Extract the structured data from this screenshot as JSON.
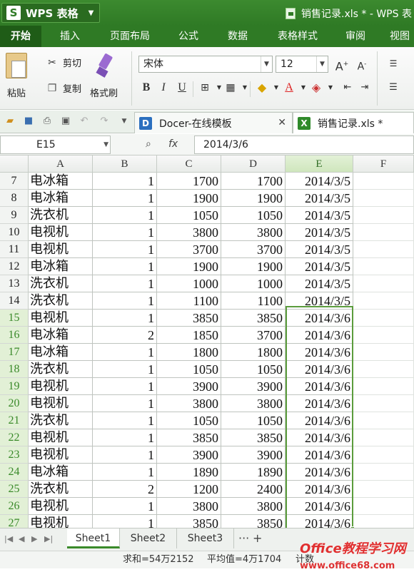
{
  "app": {
    "logo_letter": "S",
    "name": "WPS 表格",
    "window_title": "销售记录.xls * - WPS 表"
  },
  "menu": {
    "tabs": [
      "开始",
      "插入",
      "页面布局",
      "公式",
      "数据",
      "表格样式",
      "审阅",
      "视图"
    ],
    "active": "开始"
  },
  "ribbon": {
    "paste": "粘贴",
    "cut": "剪切",
    "copy": "复制",
    "format_painter": "格式刷",
    "font_name": "宋体",
    "font_size": "12",
    "bold": "B",
    "italic": "I",
    "underline": "U"
  },
  "doc_tabs": [
    {
      "label": "Docer-在线模板",
      "icon": "docer-icon"
    },
    {
      "label": "销售记录.xls *",
      "icon": "xls-icon"
    }
  ],
  "formula_bar": {
    "cell_ref": "E15",
    "fx": "fx",
    "value": "2014/3/6"
  },
  "columns": [
    "A",
    "B",
    "C",
    "D",
    "E",
    "F"
  ],
  "selected_column": "E",
  "rows": [
    {
      "n": "7",
      "a": "电冰箱",
      "b": "1",
      "c": "1700",
      "d": "1700",
      "e": "2014/3/5"
    },
    {
      "n": "8",
      "a": "电冰箱",
      "b": "1",
      "c": "1900",
      "d": "1900",
      "e": "2014/3/5"
    },
    {
      "n": "9",
      "a": "洗衣机",
      "b": "1",
      "c": "1050",
      "d": "1050",
      "e": "2014/3/5"
    },
    {
      "n": "10",
      "a": "电视机",
      "b": "1",
      "c": "3800",
      "d": "3800",
      "e": "2014/3/5"
    },
    {
      "n": "11",
      "a": "电视机",
      "b": "1",
      "c": "3700",
      "d": "3700",
      "e": "2014/3/5"
    },
    {
      "n": "12",
      "a": "电冰箱",
      "b": "1",
      "c": "1900",
      "d": "1900",
      "e": "2014/3/5"
    },
    {
      "n": "13",
      "a": "洗衣机",
      "b": "1",
      "c": "1000",
      "d": "1000",
      "e": "2014/3/5"
    },
    {
      "n": "14",
      "a": "洗衣机",
      "b": "1",
      "c": "1100",
      "d": "1100",
      "e": "2014/3/5"
    },
    {
      "n": "15",
      "a": "电视机",
      "b": "1",
      "c": "3850",
      "d": "3850",
      "e": "2014/3/6"
    },
    {
      "n": "16",
      "a": "电冰箱",
      "b": "2",
      "c": "1850",
      "d": "3700",
      "e": "2014/3/6"
    },
    {
      "n": "17",
      "a": "电冰箱",
      "b": "1",
      "c": "1800",
      "d": "1800",
      "e": "2014/3/6"
    },
    {
      "n": "18",
      "a": "洗衣机",
      "b": "1",
      "c": "1050",
      "d": "1050",
      "e": "2014/3/6"
    },
    {
      "n": "19",
      "a": "电视机",
      "b": "1",
      "c": "3900",
      "d": "3900",
      "e": "2014/3/6"
    },
    {
      "n": "20",
      "a": "电视机",
      "b": "1",
      "c": "3800",
      "d": "3800",
      "e": "2014/3/6"
    },
    {
      "n": "21",
      "a": "洗衣机",
      "b": "1",
      "c": "1050",
      "d": "1050",
      "e": "2014/3/6"
    },
    {
      "n": "22",
      "a": "电视机",
      "b": "1",
      "c": "3850",
      "d": "3850",
      "e": "2014/3/6"
    },
    {
      "n": "23",
      "a": "电视机",
      "b": "1",
      "c": "3900",
      "d": "3900",
      "e": "2014/3/6"
    },
    {
      "n": "24",
      "a": "电冰箱",
      "b": "1",
      "c": "1890",
      "d": "1890",
      "e": "2014/3/6"
    },
    {
      "n": "25",
      "a": "洗衣机",
      "b": "2",
      "c": "1200",
      "d": "2400",
      "e": "2014/3/6"
    },
    {
      "n": "26",
      "a": "电视机",
      "b": "1",
      "c": "3800",
      "d": "3800",
      "e": "2014/3/6"
    },
    {
      "n": "27",
      "a": "电视机",
      "b": "1",
      "c": "3850",
      "d": "3850",
      "e": "2014/3/6"
    }
  ],
  "selected_rows": [
    "15",
    "16",
    "17",
    "18",
    "19",
    "20",
    "21",
    "22",
    "23",
    "24",
    "25",
    "26",
    "27"
  ],
  "sheets": [
    "Sheet1",
    "Sheet2",
    "Sheet3"
  ],
  "active_sheet": "Sheet1",
  "more_sheets": "···",
  "add_sheet": "+",
  "status": {
    "sum": "求和=54万2152",
    "avg": "平均值=4万1704",
    "count": "计数"
  },
  "watermark": {
    "brand": "Office教程学习网",
    "url": "www.office68.com"
  },
  "colors": {
    "title_green": "#2f7a25",
    "selection_green": "#5b9c3c"
  }
}
